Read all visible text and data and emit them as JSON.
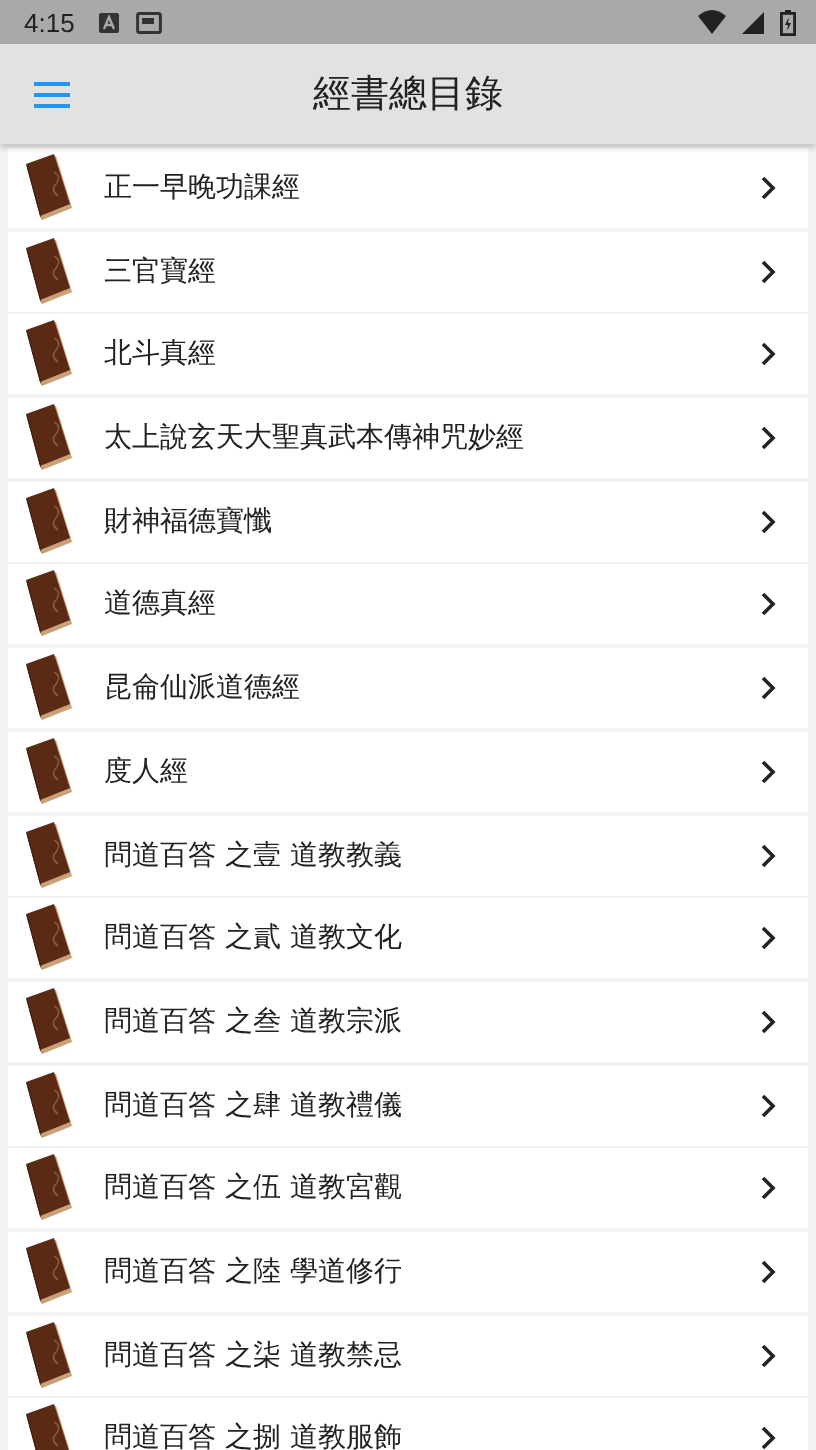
{
  "status_bar": {
    "time": "4:15"
  },
  "app_bar": {
    "title": "經書總目錄"
  },
  "items": [
    {
      "title": "正一早晚功課經"
    },
    {
      "title": "三官寶經"
    },
    {
      "title": "北斗真經"
    },
    {
      "title": "太上說玄天大聖真武本傳神咒妙經"
    },
    {
      "title": "財神福德寶懺"
    },
    {
      "title": "道德真經"
    },
    {
      "title": "昆侖仙派道德經"
    },
    {
      "title": "度人經"
    },
    {
      "title": "問道百答 之壹 道教教義"
    },
    {
      "title": "問道百答 之貳 道教文化"
    },
    {
      "title": "問道百答 之叁 道教宗派"
    },
    {
      "title": "問道百答 之肆 道教禮儀"
    },
    {
      "title": "問道百答 之伍 道教宮觀"
    },
    {
      "title": "問道百答 之陸 學道修行"
    },
    {
      "title": "問道百答 之柒 道教禁忌"
    },
    {
      "title": "問道百答 之捌 道教服飾"
    }
  ]
}
